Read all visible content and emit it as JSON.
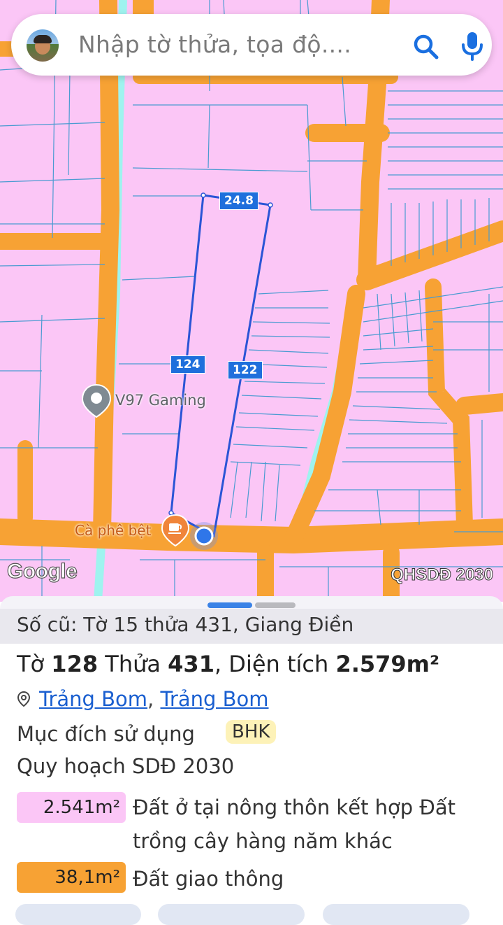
{
  "search": {
    "placeholder": "Nhập tờ thửa, tọa độ...."
  },
  "map": {
    "google_logo": "Google",
    "layer_label": "QHSDĐ 2030",
    "dimensions": {
      "top": "24.8",
      "left": "124",
      "right": "122"
    },
    "poi": {
      "name": "V97 Gaming"
    },
    "cafe": {
      "name": "Cà phê bệt"
    },
    "colors": {
      "land": "#fbc6f6",
      "road": "#f7a234",
      "water": "#9ff3ef",
      "boundary": "#4a9bd1",
      "selection": "#2a55d6"
    }
  },
  "sheet": {
    "old_record": "Số cũ: Tờ 15 thửa 431, Giang Điền",
    "sheet_label": "Tờ",
    "sheet_number": "128",
    "parcel_label": "Thửa",
    "parcel_number": "431",
    "area_label": "Diện tích",
    "area_value": "2.579m²",
    "location": {
      "district": "Trảng Bom",
      "ward": "Trảng Bom",
      "separator": ","
    },
    "purpose_label": "Mục đích sử dụng",
    "purpose_code": "BHK",
    "plan_label": "Quy hoạch SDĐ 2030",
    "plan_items": [
      {
        "area": "2.541m²",
        "description": "Đất ở tại nông thôn kết hợp Đất trồng cây hàng năm khác",
        "color": "#fbc6f6"
      },
      {
        "area": "38,1m²",
        "description": "Đất giao thông",
        "color": "#f7a234"
      }
    ]
  }
}
